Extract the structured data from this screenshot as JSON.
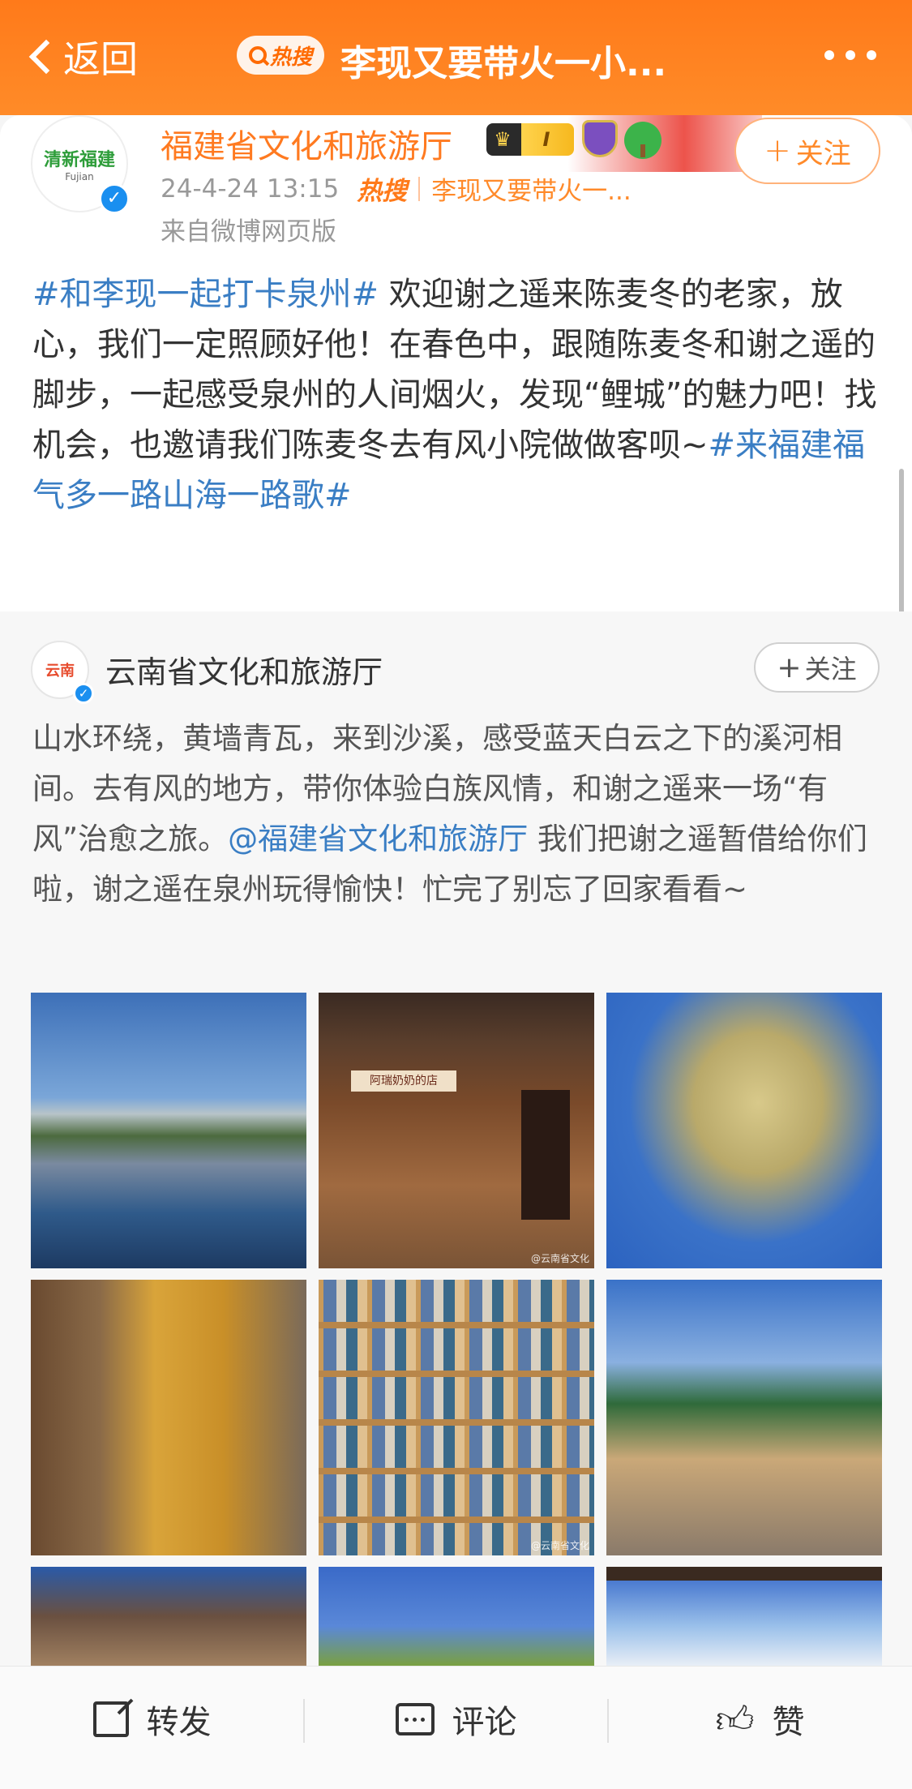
{
  "header": {
    "back_label": "返回",
    "hot_badge": "热搜",
    "title": "李现又要带火一小...",
    "more": "more-icon"
  },
  "post1": {
    "avatar_text": "清新福建",
    "avatar_sub": "Fujian",
    "author": "福建省文化和旅游厅",
    "level_badge": "I",
    "time": "24-4-24 13:15",
    "hot_label": "热搜",
    "hot_topic": "李现又要带火一...",
    "source": "来自微博网页版",
    "follow_label": "关注",
    "text_segments": [
      {
        "t": "#和李现一起打卡泉州#",
        "tag": true
      },
      {
        "t": " 欢迎谢之遥来陈麦冬的老家，放心，我们一定照顾好他！在春色中，跟随陈麦冬和谢之遥的脚步，一起感受泉州的人间烟火，发现“鲤城”的魅力吧！找机会，也邀请我们陈麦冬去有风小院做做客呗~",
        "tag": false
      },
      {
        "t": "#来福建福气多一路山海一路歌#",
        "tag": true
      }
    ]
  },
  "post2": {
    "avatar_text": "云南",
    "author": "云南省文化和旅游厅",
    "follow_label": "关注",
    "text_before": "山水环绕，黄墙青瓦，来到沙溪，感受蓝天白云之下的溪河相间。去有风的地方，带你体验白族风情，和谢之遥来一场“有风”治愈之旅。",
    "mention": "@福建省文化和旅游厅",
    "text_after": " 我们把谢之遥暂借给你们啦，谢之遥在泉州玩得愉快！忙完了别忘了回家看看~",
    "photo_sign": "阿瑞奶奶的店",
    "watermark": "@云南省文化"
  },
  "bottom": {
    "share_label": "转发",
    "comment_label": "评论",
    "like_label": "赞"
  }
}
